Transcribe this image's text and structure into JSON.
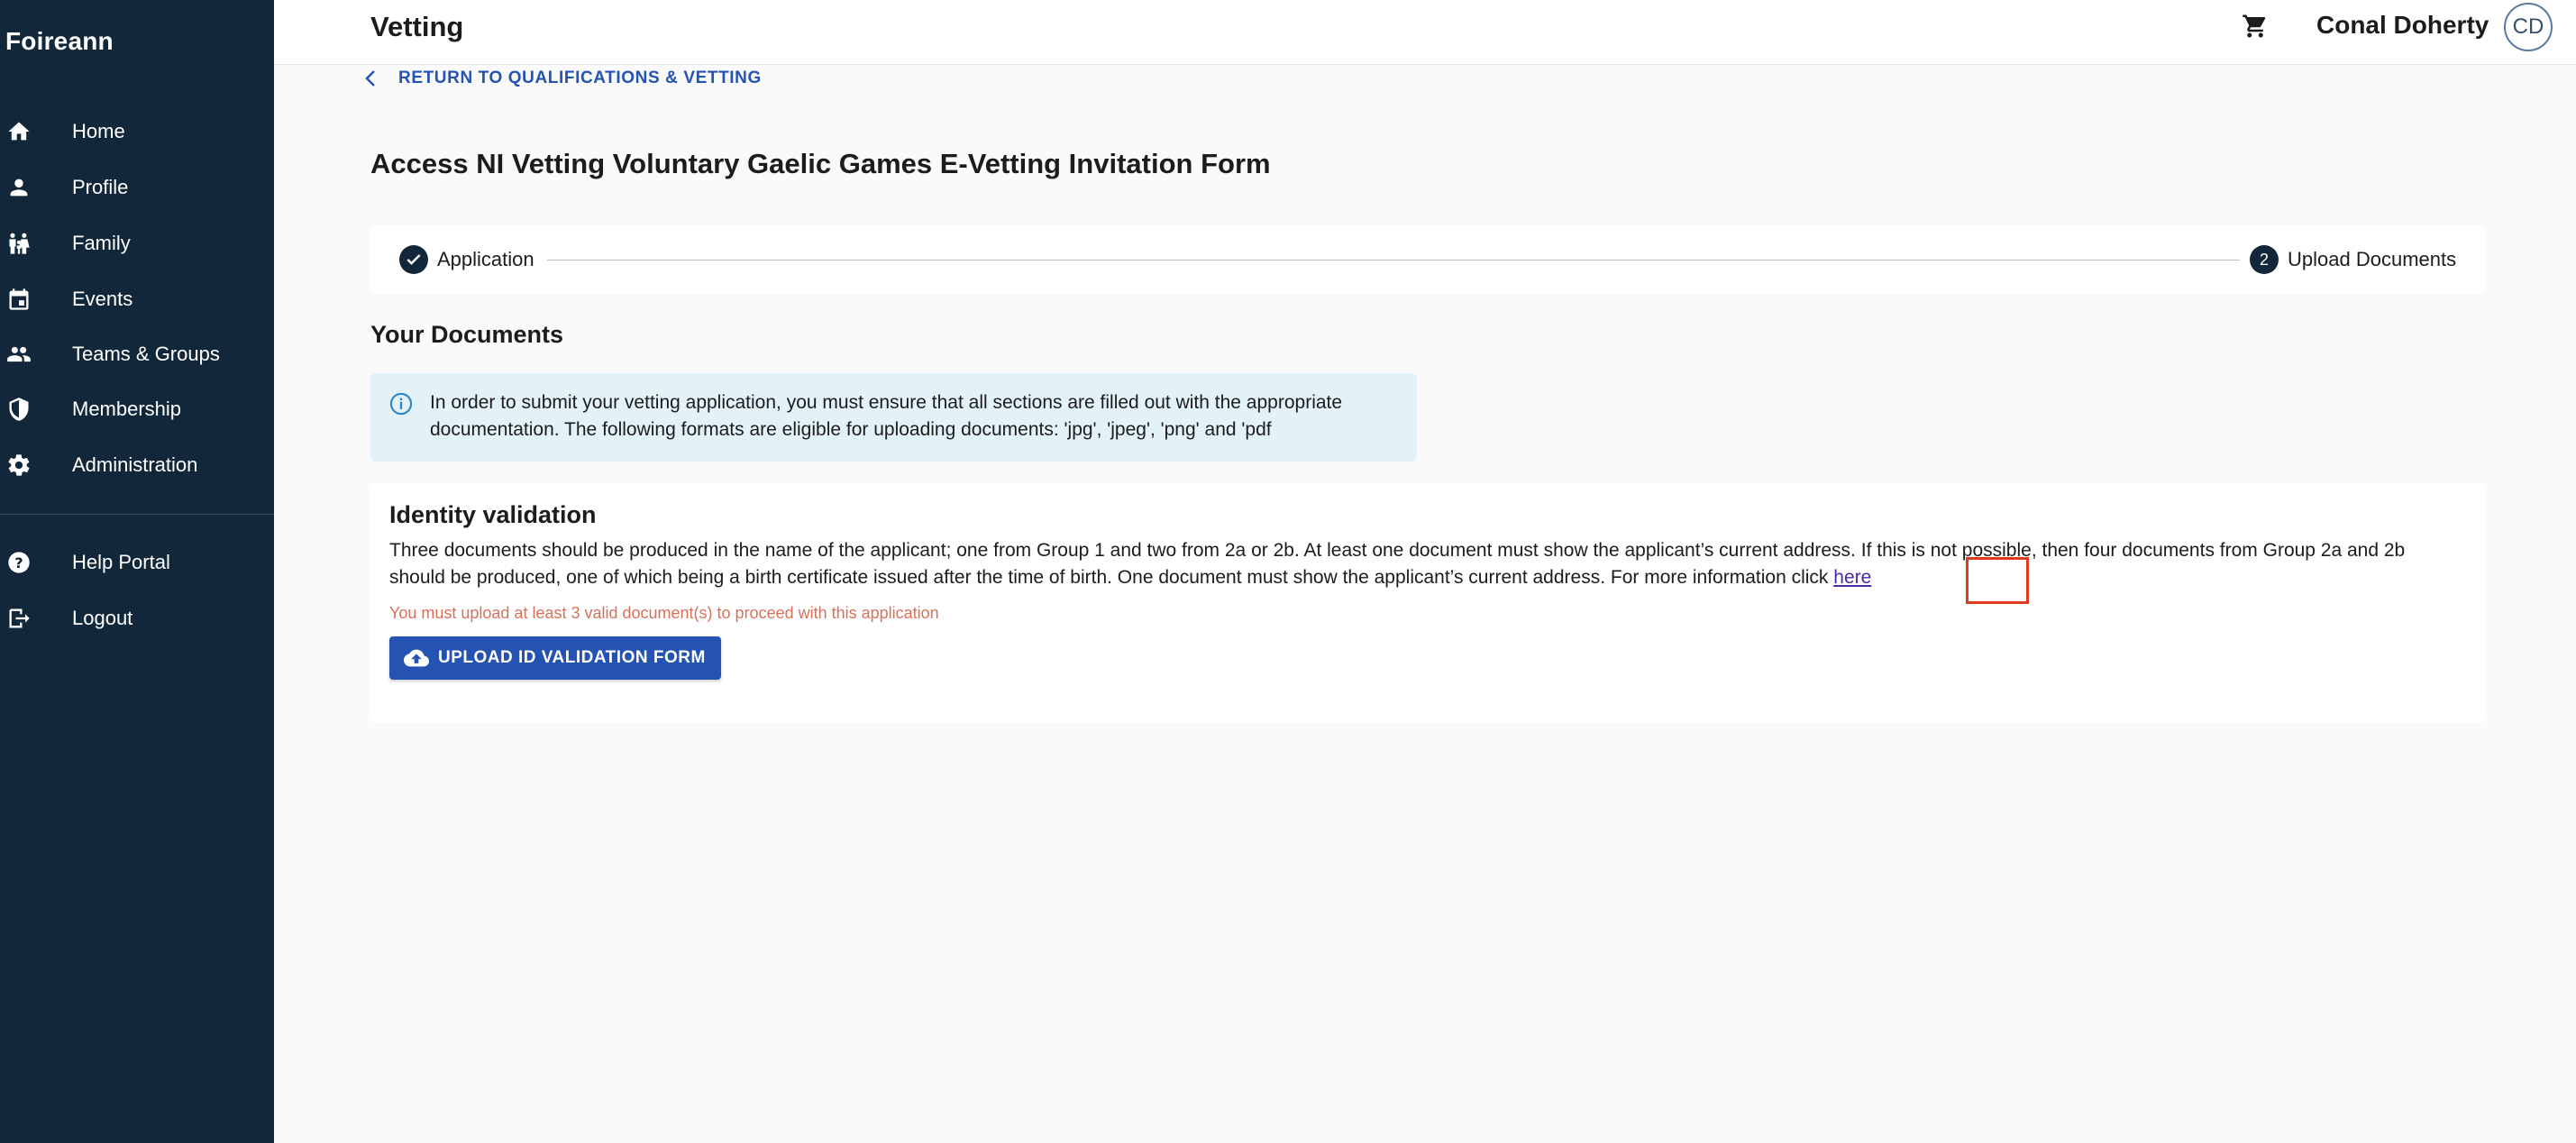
{
  "app": {
    "brand": "Foireann"
  },
  "sidebar": {
    "items": [
      {
        "label": "Home",
        "icon": "home-icon"
      },
      {
        "label": "Profile",
        "icon": "person-icon"
      },
      {
        "label": "Family",
        "icon": "family-icon"
      },
      {
        "label": "Events",
        "icon": "calendar-icon"
      },
      {
        "label": "Teams & Groups",
        "icon": "groups-icon"
      },
      {
        "label": "Membership",
        "icon": "shield-icon"
      },
      {
        "label": "Administration",
        "icon": "gear-icon"
      }
    ],
    "footer_items": [
      {
        "label": "Help Portal",
        "icon": "help-icon"
      },
      {
        "label": "Logout",
        "icon": "logout-icon"
      }
    ]
  },
  "header": {
    "title": "Vetting",
    "user_name": "Conal Doherty",
    "avatar_initials": "CD"
  },
  "main": {
    "back_link": "RETURN TO QUALIFICATIONS & VETTING",
    "form_title": "Access NI Vetting Voluntary Gaelic Games E-Vetting Invitation Form",
    "stepper": {
      "steps": [
        {
          "label": "Application",
          "state": "completed"
        },
        {
          "number": "2",
          "label": "Upload Documents",
          "state": "active"
        }
      ]
    },
    "section_title": "Your Documents",
    "info_text": "In order to submit your vetting application, you must ensure that all sections are filled out with the appropriate documentation. The following formats are eligible for uploading documents: 'jpg', 'jpeg', 'png' and 'pdf",
    "identity": {
      "title": "Identity validation",
      "description": "Three documents should be produced in the name of the applicant; one from Group 1 and two from 2a or 2b. At least one document must show the applicant’s current address. If this is not possible, then four documents from Group 2a and 2b should be produced, one of which being a birth certificate issued after the time of birth. One document must show the applicant’s current address. For more information click",
      "link_text": "here",
      "warning": "You must upload at least 3 valid document(s) to proceed with this application",
      "upload_button": "UPLOAD ID VALIDATION FORM"
    }
  },
  "colors": {
    "sidebar_bg": "#12283a",
    "accent": "#2453b3",
    "info_bg": "#e3f2f8",
    "warning": "#d7715b",
    "highlight": "#e03a1e"
  }
}
